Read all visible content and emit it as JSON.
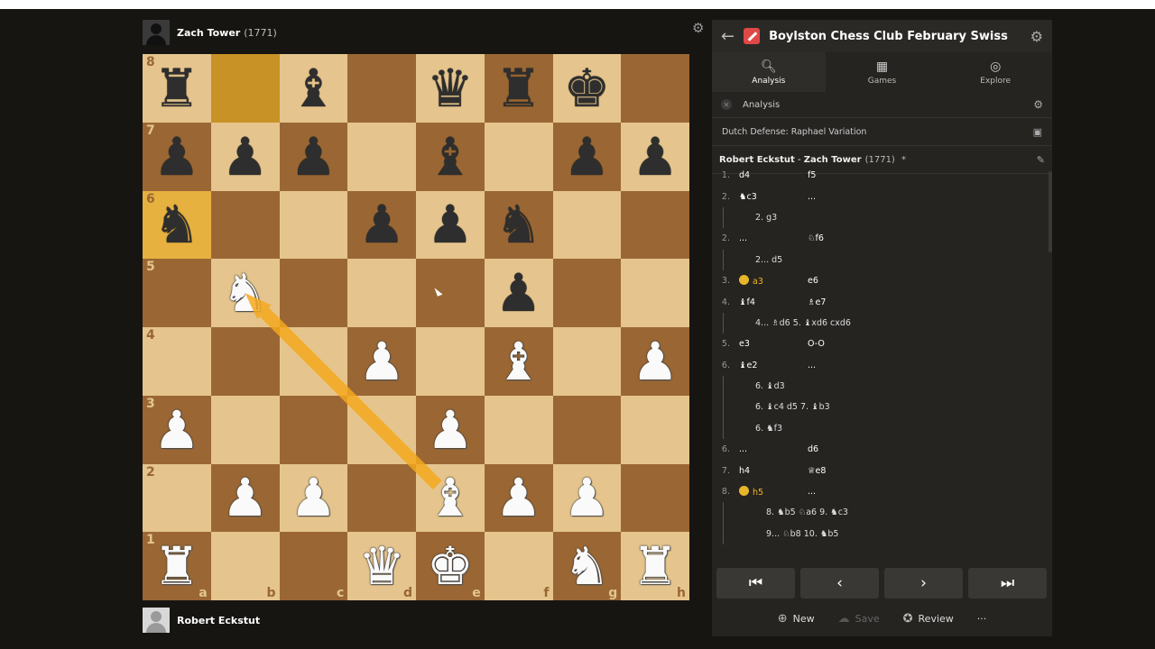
{
  "players": {
    "top": {
      "name": "Zach Tower",
      "rating": "(1771)"
    },
    "bottom": {
      "name": "Robert Eckstut"
    }
  },
  "board": {
    "ranks": [
      "8",
      "7",
      "6",
      "5",
      "4",
      "3",
      "2",
      "1"
    ],
    "files": [
      "a",
      "b",
      "c",
      "d",
      "e",
      "f",
      "g",
      "h"
    ],
    "pieces": {
      "a8": "bR",
      "c8": "bB",
      "e8": "bQ",
      "f8": "bR",
      "g8": "bK",
      "a7": "bP",
      "b7": "bP",
      "c7": "bP",
      "e7": "bB",
      "g7": "bP",
      "h7": "bP",
      "a6": "bN",
      "d6": "bP",
      "e6": "bP",
      "f6": "bN",
      "b5": "wN",
      "f5": "bP",
      "d4": "wP",
      "f4": "wB",
      "h4": "wP",
      "a3": "wP",
      "e3": "wP",
      "b2": "wP",
      "c2": "wP",
      "e2": "wB",
      "f2": "wP",
      "g2": "wP",
      "a1": "wR",
      "d1": "wQ",
      "e1": "wK",
      "g1": "wN",
      "h1": "wR"
    },
    "highlights": [
      "b8",
      "a6"
    ],
    "arrow": {
      "from": "e2",
      "to": "b5"
    }
  },
  "panel": {
    "title": "Boylston Chess Club February Swiss",
    "tabs": [
      {
        "label": "Analysis",
        "icon": "magnifier-icon"
      },
      {
        "label": "Games",
        "icon": "games-icon"
      },
      {
        "label": "Explore",
        "icon": "compass-icon"
      }
    ],
    "analysis_label": "Analysis",
    "opening": "Dutch Defense: Raphael Variation",
    "pgn_white": "Robert Eckstut",
    "pgn_sep": "-",
    "pgn_black": "Zach Tower",
    "pgn_rating": "(1771)",
    "pgn_mark": "*"
  },
  "moves": [
    {
      "type": "main",
      "n": "1.",
      "w": "d4",
      "b": "f5"
    },
    {
      "type": "main",
      "n": "2.",
      "w": "♞c3",
      "b": "..."
    },
    {
      "type": "var",
      "text": "2. g3"
    },
    {
      "type": "main",
      "n": "2.",
      "w": "...",
      "b": "♘f6"
    },
    {
      "type": "var",
      "text": "2... d5"
    },
    {
      "type": "main",
      "n": "3.",
      "w": "a3",
      "b": "e6",
      "badge": true
    },
    {
      "type": "main",
      "n": "4.",
      "w": "♝f4",
      "b": "♗e7"
    },
    {
      "type": "var",
      "text": "4... ♗d6  5. ♝xd6  cxd6"
    },
    {
      "type": "main",
      "n": "5.",
      "w": "e3",
      "b": "O-O"
    },
    {
      "type": "main",
      "n": "6.",
      "w": "♝e2",
      "b": "..."
    },
    {
      "type": "var",
      "text": "6. ♝d3"
    },
    {
      "type": "var",
      "text": "6. ♝c4  d5  7. ♝b3"
    },
    {
      "type": "var",
      "text": "6. ♞f3"
    },
    {
      "type": "main",
      "n": "6.",
      "w": "...",
      "b": "d6"
    },
    {
      "type": "main",
      "n": "7.",
      "w": "h4",
      "b": "♕e8"
    },
    {
      "type": "main",
      "n": "8.",
      "w": "h5",
      "b": "...",
      "badge": true
    },
    {
      "type": "var",
      "text": "8. ♞b5  ♘a6  9. ♞c3"
    },
    {
      "type": "var",
      "text": "9... ♘b8  10. ♞b5"
    }
  ],
  "nav": {
    "first": "⏮",
    "prev": "‹",
    "next": "›",
    "last": "⏭"
  },
  "actions": {
    "new": "New",
    "save": "Save",
    "review": "Review",
    "more": "···"
  }
}
